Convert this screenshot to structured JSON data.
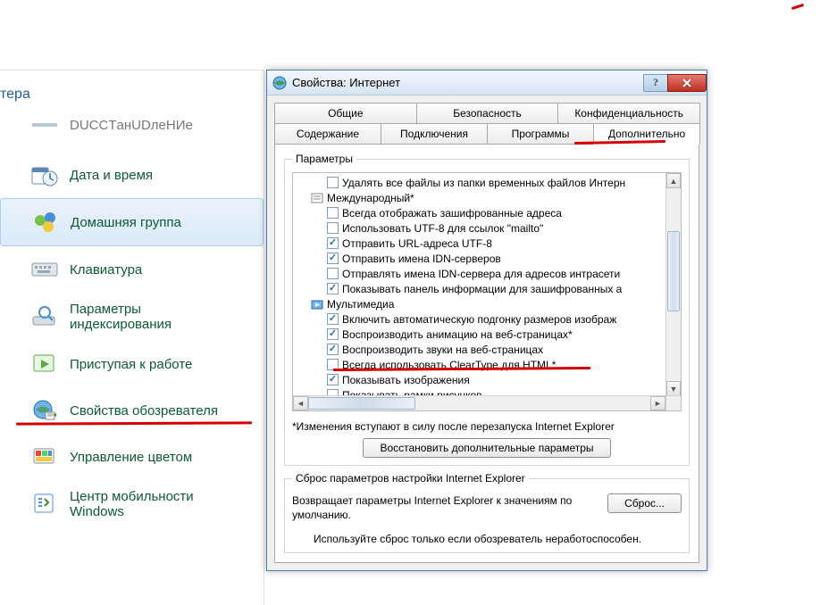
{
  "panel": {
    "header_suffix": "тера",
    "items": [
      {
        "label": "DUCCTанUDлеНИе",
        "icon": "restore-icon",
        "cut": true
      },
      {
        "label": "Дата и время",
        "icon": "clock-icon"
      },
      {
        "label": "Домашняя группа",
        "icon": "homegroup-icon",
        "highlight": true
      },
      {
        "label": "Клавиатура",
        "icon": "keyboard-icon"
      },
      {
        "label": "Параметры индексирования",
        "icon": "indexing-icon",
        "multiline": true
      },
      {
        "label": "Приступая к работе",
        "icon": "getting-started-icon"
      },
      {
        "label": "Свойства обозревателя",
        "icon": "internet-options-icon"
      },
      {
        "label": "Управление цветом",
        "icon": "color-mgmt-icon"
      },
      {
        "label": "Центр мобильности Windows",
        "icon": "mobility-icon",
        "multiline": true
      }
    ]
  },
  "dialog": {
    "title": "Свойства: Интернет",
    "help": "?",
    "tabs_row1": [
      "Общие",
      "Безопасность",
      "Конфиденциальность"
    ],
    "tabs_row2": [
      "Содержание",
      "Подключения",
      "Программы",
      "Дополнительно"
    ],
    "active_tab": "Дополнительно",
    "group_params": "Параметры",
    "restart_note": "*Изменения вступают в силу после перезапуска Internet Explorer",
    "restore_btn": "Восстановить дополнительные параметры",
    "reset_group": "Сброс параметров настройки Internet Explorer",
    "reset_desc": "Возвращает параметры Internet Explorer к значениям по умолчанию.",
    "reset_btn": "Сброс...",
    "reset_info": "Используйте сброс только если обозреватель неработоспособен."
  },
  "tree": {
    "nodes": [
      {
        "type": "item",
        "indent": true,
        "checked": false,
        "label": "Удалять все файлы из папки временных файлов Интерн"
      },
      {
        "type": "category",
        "icon": "intl-icon",
        "label": "Международный*"
      },
      {
        "type": "item",
        "indent": true,
        "checked": false,
        "label": "Всегда отображать зашифрованные адреса"
      },
      {
        "type": "item",
        "indent": true,
        "checked": false,
        "label": "Использовать UTF-8 для ссылок \"mailto\""
      },
      {
        "type": "item",
        "indent": true,
        "checked": true,
        "label": "Отправить URL-адреса UTF-8"
      },
      {
        "type": "item",
        "indent": true,
        "checked": true,
        "label": "Отправить имена IDN-серверов"
      },
      {
        "type": "item",
        "indent": true,
        "checked": false,
        "label": "Отправлять имена IDN-сервера для адресов интрасети"
      },
      {
        "type": "item",
        "indent": true,
        "checked": true,
        "label": "Показывать панель информации для зашифрованных а"
      },
      {
        "type": "category",
        "icon": "media-icon",
        "label": "Мультимедиа"
      },
      {
        "type": "item",
        "indent": true,
        "checked": true,
        "label": "Включить автоматическую подгонку размеров изображ"
      },
      {
        "type": "item",
        "indent": true,
        "checked": true,
        "label": "Воспроизводить анимацию на веб-страницах*"
      },
      {
        "type": "item",
        "indent": true,
        "checked": true,
        "label": "Воспроизводить звуки на веб-страницах"
      },
      {
        "type": "item",
        "indent": true,
        "checked": false,
        "label": "Всегда использовать ClearType для HTML*"
      },
      {
        "type": "item",
        "indent": true,
        "checked": true,
        "label": "Показывать изображения"
      },
      {
        "type": "item",
        "indent": true,
        "checked": false,
        "label": "Показывать рамки рисунков"
      }
    ]
  }
}
